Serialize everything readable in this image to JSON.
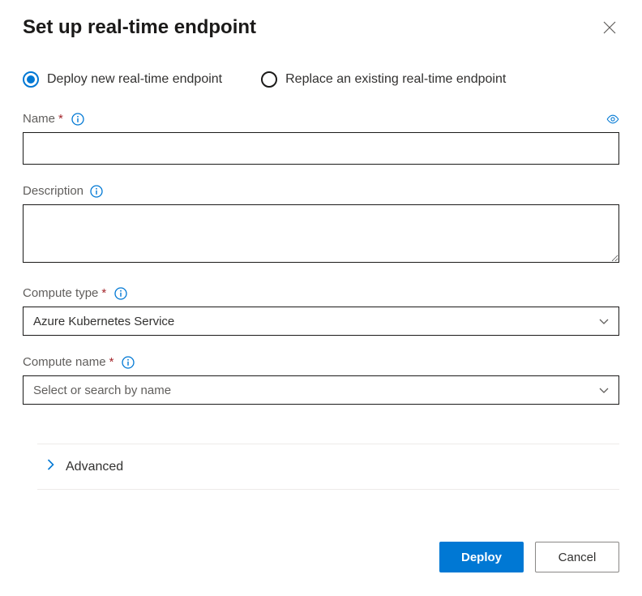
{
  "header": {
    "title": "Set up real-time endpoint"
  },
  "radios": {
    "options": [
      {
        "label": "Deploy new real-time endpoint",
        "selected": true
      },
      {
        "label": "Replace an existing real-time endpoint",
        "selected": false
      }
    ]
  },
  "fields": {
    "name": {
      "label": "Name",
      "required": true,
      "value": ""
    },
    "description": {
      "label": "Description",
      "required": false,
      "value": ""
    },
    "compute_type": {
      "label": "Compute type",
      "required": true,
      "value": "Azure Kubernetes Service"
    },
    "compute_name": {
      "label": "Compute name",
      "required": true,
      "placeholder": "Select or search by name",
      "value": ""
    }
  },
  "advanced": {
    "label": "Advanced"
  },
  "buttons": {
    "deploy": "Deploy",
    "cancel": "Cancel"
  }
}
